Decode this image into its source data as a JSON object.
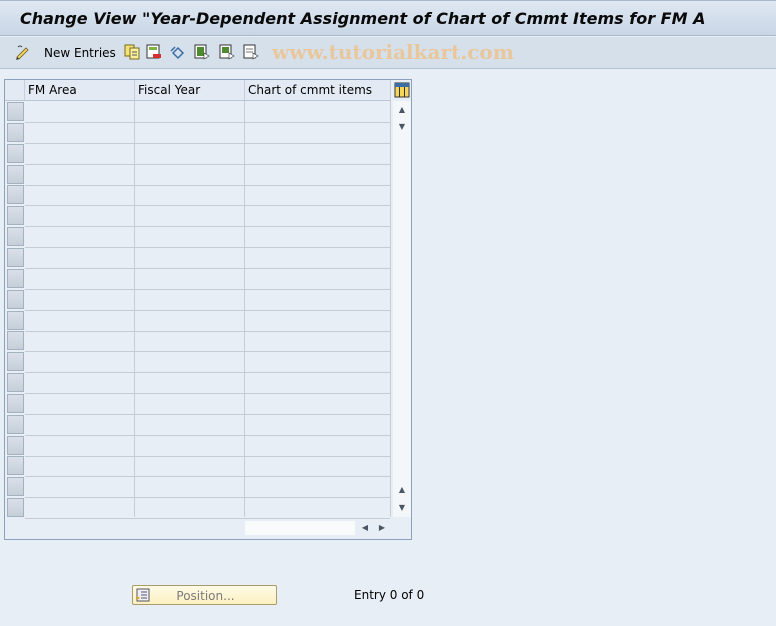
{
  "window": {
    "title": "Change View \"Year-Dependent Assignment of Chart of Cmmt Items for FM A"
  },
  "toolbar": {
    "items": [
      {
        "name": "change-display-icon",
        "label": ""
      },
      {
        "name": "new-entries-button",
        "label": "New Entries"
      },
      {
        "name": "copy-as-icon",
        "label": ""
      },
      {
        "name": "delete-icon",
        "label": ""
      },
      {
        "name": "undo-change-icon",
        "label": ""
      },
      {
        "name": "select-all-icon",
        "label": ""
      },
      {
        "name": "select-block-icon",
        "label": ""
      },
      {
        "name": "deselect-all-icon",
        "label": ""
      }
    ],
    "new_entries_label": "New Entries",
    "watermark": "www.tutorialkart.com"
  },
  "table": {
    "columns": [
      "FM Area",
      "Fiscal Year",
      "Chart of cmmt items"
    ],
    "row_count_visible": 20,
    "rows": []
  },
  "footer": {
    "position_button_label": "Position...",
    "entry_status": "Entry 0 of 0"
  },
  "colors": {
    "background": "#e8eef6",
    "watermark": "#e9c79d",
    "position_button": "#fbf0c0"
  }
}
